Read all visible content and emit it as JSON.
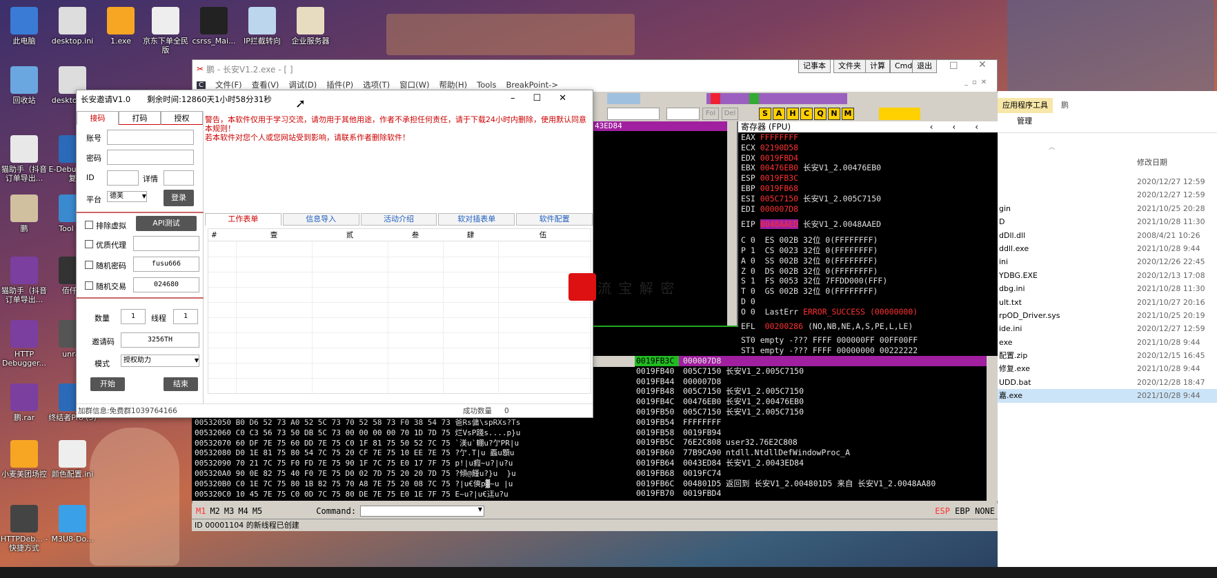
{
  "desktop": {
    "icons": [
      {
        "label": "此电脑",
        "color": "#3a7bd5"
      },
      {
        "label": "desktop.ini",
        "color": "#dddddd"
      },
      {
        "label": "1.exe",
        "color": "#f6a623"
      },
      {
        "label": "京东下单全民版",
        "color": "#eeeeee"
      },
      {
        "label": "csrss_Mai...",
        "color": "#222222"
      },
      {
        "label": "IP拦截转向",
        "color": "#bcd6ee"
      },
      {
        "label": "企业服务器",
        "color": "#e8dcc0"
      },
      {
        "label": "回收站",
        "color": "#6aa7e0"
      },
      {
        "label": "desktop.ini",
        "color": "#dddddd"
      },
      {
        "label": "猫助手（抖音订单导出...",
        "color": "#e8e8e8"
      },
      {
        "label": "E-Debug于修复",
        "color": "#2a6ab8"
      },
      {
        "label": "鹏",
        "color": "#d0c0a0"
      },
      {
        "label": "Tool Kit",
        "color": "#3a8ad0"
      },
      {
        "label": "猫助手（抖音订单导出...",
        "color": "#7b3fa0"
      },
      {
        "label": "佰仟Q",
        "color": "#333333"
      },
      {
        "label": "HTTP Debugger...",
        "color": "#7b3fa0"
      },
      {
        "label": "unrar",
        "color": "#555555"
      },
      {
        "label": "鹏.rar",
        "color": "#7b3fa0"
      },
      {
        "label": "终结者Pro (5)",
        "color": "#2a6ab8"
      },
      {
        "label": "小麦美团场控",
        "color": "#f6a623"
      },
      {
        "label": "颜色配置.ini",
        "color": "#eeeeee"
      },
      {
        "label": "HTTPDeb... - 快捷方式",
        "color": "#444444"
      },
      {
        "label": "M3U8-Do...",
        "color": "#3aa0e8"
      }
    ]
  },
  "od_window": {
    "title": "鹏 - 长安V1.2.exe - [ ]",
    "menu": [
      "文件(F)",
      "查看(V)",
      "调试(D)",
      "插件(P)",
      "选项(T)",
      "窗口(W)",
      "帮助(H)",
      "Tools",
      "BreakPoint->"
    ],
    "top_buttons": [
      "记事本",
      "文件夹",
      "计算",
      "Cmd",
      "退出"
    ],
    "toolbar_letters": [
      "S",
      "A",
      "H",
      "C",
      "Q",
      "N",
      "M"
    ],
    "fol_label": "Fol",
    "del_label": "Del",
    "disasm_addr": "43ED84",
    "registers_title": "寄存器 (FPU)",
    "registers": [
      {
        "name": "EAX",
        "value": "FFFFFFFF",
        "comment": ""
      },
      {
        "name": "ECX",
        "value": "02190D58",
        "comment": ""
      },
      {
        "name": "EDX",
        "value": "0019FBD4",
        "comment": ""
      },
      {
        "name": "EBX",
        "value": "00476EB0",
        "comment": "长安V1_2.00476EB0"
      },
      {
        "name": "ESP",
        "value": "0019FB3C",
        "comment": ""
      },
      {
        "name": "EBP",
        "value": "0019FB68",
        "comment": ""
      },
      {
        "name": "ESI",
        "value": "005C7150",
        "comment": "长安V1_2.005C7150"
      },
      {
        "name": "EDI",
        "value": "000007D8",
        "comment": ""
      }
    ],
    "eip": {
      "name": "EIP",
      "value": "0048AAED",
      "comment": "长安V1_2.0048AAED"
    },
    "flags": [
      "C 0  ES 002B 32位 0(FFFFFFFF)",
      "P 1  CS 0023 32位 0(FFFFFFFF)",
      "A 0  SS 002B 32位 0(FFFFFFFF)",
      "Z 0  DS 002B 32位 0(FFFFFFFF)",
      "S 1  FS 0053 32位 7FFDD000(FFF)",
      "T 0  GS 002B 32位 0(FFFFFFFF)",
      "D 0"
    ],
    "lasterr_prefix": "O 0  LastErr ",
    "lasterr_value": "ERROR_SUCCESS (00000000)",
    "efl": {
      "label": "EFL",
      "value": "00200286",
      "comment": "(NO,NB,NE,A,S,PE,L,LE)"
    },
    "st0": "ST0 empty -??? FFFF 000000FF 00FF00FF",
    "st1": "ST1 empty -??? FFFF 00000000 00222222",
    "stack": [
      {
        "addr": "0019FB3C",
        "val": "000007D8",
        "comment": ""
      },
      {
        "addr": "0019FB40",
        "val": "005C7150",
        "comment": "长安V1_2.005C7150"
      },
      {
        "addr": "0019FB44",
        "val": "000007D8",
        "comment": ""
      },
      {
        "addr": "0019FB48",
        "val": "005C7150",
        "comment": "长安V1_2.005C7150"
      },
      {
        "addr": "0019FB4C",
        "val": "00476EB0",
        "comment": "长安V1_2.00476EB0"
      },
      {
        "addr": "0019FB50",
        "val": "005C7150",
        "comment": "长安V1_2.005C7150"
      },
      {
        "addr": "0019FB54",
        "val": "FFFFFFFF",
        "comment": ""
      },
      {
        "addr": "0019FB58",
        "val": "0019FB94",
        "comment": ""
      },
      {
        "addr": "0019FB5C",
        "val": "76E2C808",
        "comment": "user32.76E2C808"
      },
      {
        "addr": "0019FB60",
        "val": "77B9CA90",
        "comment": "ntdll.NtdllDefWindowProc_A"
      },
      {
        "addr": "0019FB64",
        "val": "0043ED84",
        "comment": "长安V1_2.0043ED84"
      },
      {
        "addr": "0019FB68",
        "val": "0019FC74",
        "comment": ""
      },
      {
        "addr": "0019FB6C",
        "val": "004801D5",
        "comment": "返回到 长安V1_2.004801D5 来自 长安V1_2.0048AA80"
      },
      {
        "addr": "0019FB70",
        "val": "0019FBD4",
        "comment": ""
      }
    ],
    "dump": [
      "00532050 B0 D6 52 73 A0 52 5C 73 70 52 58 73 F0 38 54 73 爸Rs傭\\spRXs?Ts",
      "00532060 C0 C3 56 73 50 DB 5C 73 00 00 00 00 70 1D 7D 75 烂VsP踐s....p}u",
      "00532070 60 DF 7E 75 60 DD 7E 75 C0 1F 81 75 50 52 7C 75 `渼u`輣u?亇PR|u",
      "00532080 D0 1E 81 75 80 54 7C 75 20 CF 7E 75 10 EE 7E 75 ?亇.T|u 蟸u顋u",
      "00532090 70 21 7C 75 F0 FD 7E 75 90 1F 7C 75 E0 17 7F 75 p!|u瘕~u?|u?u",
      "005320A0 90 0E 82 75 40 F0 7E 75 D0 02 7D 75 20 20 7D 75 ?傾@饉u?}u  }u",
      "005320B0 C0 1E 7C 75 80 1B 82 75 70 A8 7E 75 20 08 7C 75 ?|u€傸p▓~u |u",
      "005320C0 10 45 7E 75 C0 0D 7C 75 80 DE 7E 75 E0 1E 7F 75 E~u?|u€迋u?u"
    ],
    "m_buttons": [
      "M1",
      "M2",
      "M3",
      "M4",
      "M5"
    ],
    "command_label": "Command:",
    "bottom_right": [
      "ESP",
      "EBP",
      "NONE"
    ],
    "status": "ID 00001104 的新线程已创建"
  },
  "ca_window": {
    "title": "长安邀请V1.0",
    "remaining": "剩余时间:12860天1小时58分31秒",
    "left_tabs": [
      "接码",
      "打码",
      "授权"
    ],
    "account_label": "账号",
    "password_label": "密码",
    "id_label": "ID",
    "detail_label": "详情",
    "platform_label": "平台",
    "platform_value": "德芙",
    "login_button": "登录",
    "exclude_vm": "排除虚拟",
    "api_test": "API测试",
    "quality_proxy": "优质代理",
    "random_password": "随机密码",
    "random_password_value": "fusu666",
    "random_trade": "随机交易",
    "random_trade_value": "024680",
    "quantity_label": "数量",
    "quantity_value": "1",
    "threads_label": "线程",
    "threads_value": "1",
    "invite_label": "邀请码",
    "invite_value": "3256TH",
    "mode_label": "模式",
    "mode_value": "授权助力",
    "start_button": "开始",
    "end_button": "结束",
    "warning_1": "警告，本软件仅用于学习交流，请勿用于其他用途，作者不承担任何责任，请于下载24小时内删除，使用默认同意本规则！",
    "warning_2": "若本软件对您个人或您网站受到影响，请联系作者删除软件！",
    "right_tabs": [
      "工作表单",
      "信息导入",
      "活动介绍",
      "软对插表单",
      "软件配置"
    ],
    "grid_headers": [
      "#",
      "壹",
      "贰",
      "叁",
      "肆",
      "伍"
    ],
    "footer_group": "加群信息:免费群1039764166",
    "success_label": "成功数量",
    "success_value": "0"
  },
  "explorer": {
    "ribbon_tab": "应用程序工具",
    "ribbon_label": "鹏",
    "manage": "管理",
    "date_header": "修改日期",
    "files": [
      {
        "name": "",
        "date": "2020/12/27 12:59"
      },
      {
        "name": "",
        "date": "2020/12/27 12:59"
      },
      {
        "name": "gin",
        "date": "2021/10/25 20:28"
      },
      {
        "name": "D",
        "date": "2021/10/28 11:30"
      },
      {
        "name": "dDll.dll",
        "date": "2008/4/21 10:26"
      },
      {
        "name": "ddll.exe",
        "date": "2021/10/28 9:44"
      },
      {
        "name": "ini",
        "date": "2020/12/26 22:45"
      },
      {
        "name": "YDBG.EXE",
        "date": "2020/12/13 17:08"
      },
      {
        "name": "dbg.ini",
        "date": "2021/10/28 11:30"
      },
      {
        "name": "ult.txt",
        "date": "2021/10/27 20:16"
      },
      {
        "name": "rpOD_Driver.sys",
        "date": "2021/10/25 20:19"
      },
      {
        "name": "ide.ini",
        "date": "2020/12/27 12:59"
      },
      {
        "name": "exe",
        "date": "2021/10/28 9:44"
      },
      {
        "name": "配置.zip",
        "date": "2020/12/15 16:45"
      },
      {
        "name": "修复.exe",
        "date": "2021/10/28 9:44"
      },
      {
        "name": "UDD.bat",
        "date": "2020/12/28 18:47"
      },
      {
        "name": "嘉.exe",
        "date": "2021/10/28 9:44"
      }
    ]
  },
  "watermark": "流 宝 解 密"
}
